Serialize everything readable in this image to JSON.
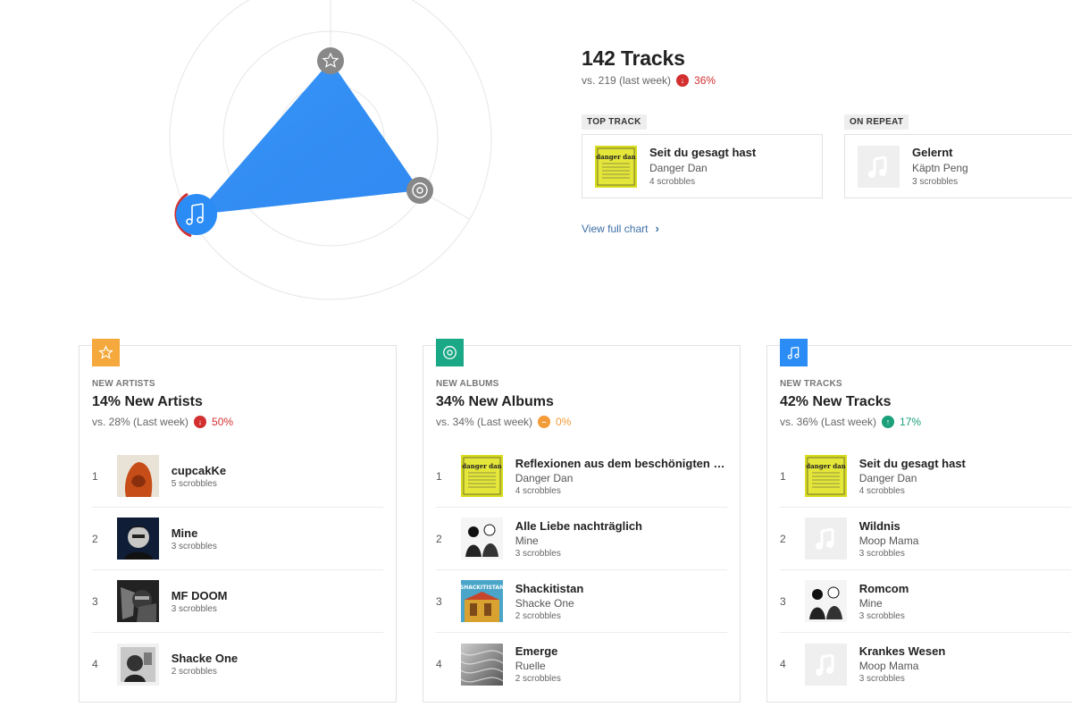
{
  "summary": {
    "title": "142 Tracks",
    "comparison": "vs. 219 (last week)",
    "change_pct": "36%",
    "change_dir": "down"
  },
  "top_track": {
    "tag": "TOP TRACK",
    "name": "Seit du gesagt hast",
    "artist": "Danger Dan",
    "scrobbles": "4 scrobbles",
    "art": "danger-dan-cover"
  },
  "on_repeat": {
    "tag": "ON REPEAT",
    "name": "Gelernt",
    "artist": "Käptn Peng",
    "scrobbles": "3 scrobbles",
    "art": "music-note-placeholder"
  },
  "view_chart_label": "View full chart",
  "radar": {
    "icons": [
      "star-icon",
      "disc-icon",
      "music-note-icon"
    ],
    "active": "music-note-icon",
    "accent": "#2b8cf5"
  },
  "cards": [
    {
      "icon": "star-icon",
      "icon_color": "#f5a83c",
      "label": "NEW ARTISTS",
      "title": "14% New Artists",
      "comparison": "vs. 28% (Last week)",
      "change_pct": "50%",
      "change_dir": "down",
      "items": [
        {
          "rank": "1",
          "name": "cupcakKe",
          "artist": "",
          "scrobbles": "5 scrobbles",
          "art": "cupcakke-photo"
        },
        {
          "rank": "2",
          "name": "Mine",
          "artist": "",
          "scrobbles": "3 scrobbles",
          "art": "mine-photo"
        },
        {
          "rank": "3",
          "name": "MF DOOM",
          "artist": "",
          "scrobbles": "3 scrobbles",
          "art": "mf-doom-photo"
        },
        {
          "rank": "4",
          "name": "Shacke One",
          "artist": "",
          "scrobbles": "2 scrobbles",
          "art": "shacke-one-photo"
        }
      ]
    },
    {
      "icon": "disc-icon",
      "icon_color": "#1aa886",
      "label": "NEW ALBUMS",
      "title": "34% New Albums",
      "comparison": "vs. 34% (Last week)",
      "change_pct": "0%",
      "change_dir": "flat",
      "items": [
        {
          "rank": "1",
          "name": "Reflexionen aus dem beschönigten L…",
          "artist": "Danger Dan",
          "scrobbles": "4 scrobbles",
          "art": "danger-dan-cover"
        },
        {
          "rank": "2",
          "name": "Alle Liebe nachträglich",
          "artist": "Mine",
          "scrobbles": "3 scrobbles",
          "art": "mine-album-cover"
        },
        {
          "rank": "3",
          "name": "Shackitistan",
          "artist": "Shacke One",
          "scrobbles": "2 scrobbles",
          "art": "shackitistan-cover"
        },
        {
          "rank": "4",
          "name": "Emerge",
          "artist": "Ruelle",
          "scrobbles": "2 scrobbles",
          "art": "emerge-cover"
        }
      ]
    },
    {
      "icon": "music-note-icon",
      "icon_color": "#2b8cf5",
      "label": "NEW TRACKS",
      "title": "42% New Tracks",
      "comparison": "vs. 36% (Last week)",
      "change_pct": "17%",
      "change_dir": "up",
      "items": [
        {
          "rank": "1",
          "name": "Seit du gesagt hast",
          "artist": "Danger Dan",
          "scrobbles": "4 scrobbles",
          "art": "danger-dan-cover"
        },
        {
          "rank": "2",
          "name": "Wildnis",
          "artist": "Moop Mama",
          "scrobbles": "3 scrobbles",
          "art": "music-note-placeholder"
        },
        {
          "rank": "3",
          "name": "Romcom",
          "artist": "Mine",
          "scrobbles": "3 scrobbles",
          "art": "mine-album-cover"
        },
        {
          "rank": "4",
          "name": "Krankes Wesen",
          "artist": "Moop Mama",
          "scrobbles": "3 scrobbles",
          "art": "music-note-placeholder"
        }
      ]
    }
  ]
}
